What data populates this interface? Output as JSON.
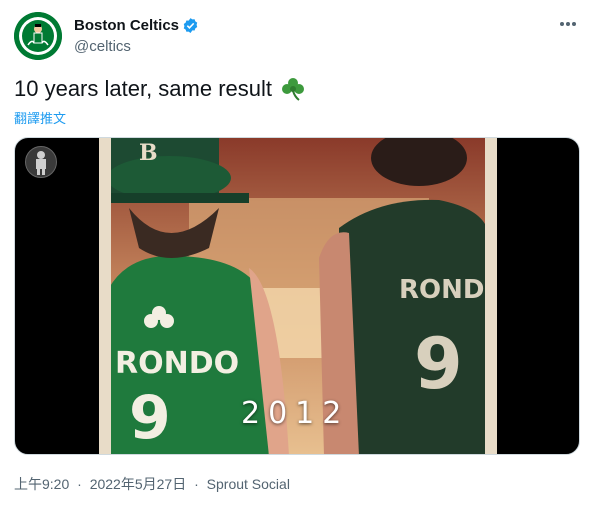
{
  "account": {
    "display_name": "Boston Celtics",
    "handle": "@celtics",
    "verified_icon": "verified-badge-icon",
    "avatar_icon": "celtics-logo-icon",
    "brand_color": "#007a33"
  },
  "tweet": {
    "text": "10 years later, same result",
    "emoji_icon": "shamrock-icon",
    "translate_label": "翻譯推文"
  },
  "media": {
    "caption": "2012",
    "jersey_left": {
      "name": "RONDO",
      "number": "9"
    },
    "jersey_right": {
      "name": "RONDO",
      "number": "9"
    },
    "hat_letter": "B"
  },
  "meta": {
    "time": "上午9:20",
    "date": "2022年5月27日",
    "source": "Sprout Social",
    "separator": "·"
  },
  "colors": {
    "accent": "#1d9bf0",
    "text_primary": "#0f1419",
    "text_secondary": "#536471"
  }
}
